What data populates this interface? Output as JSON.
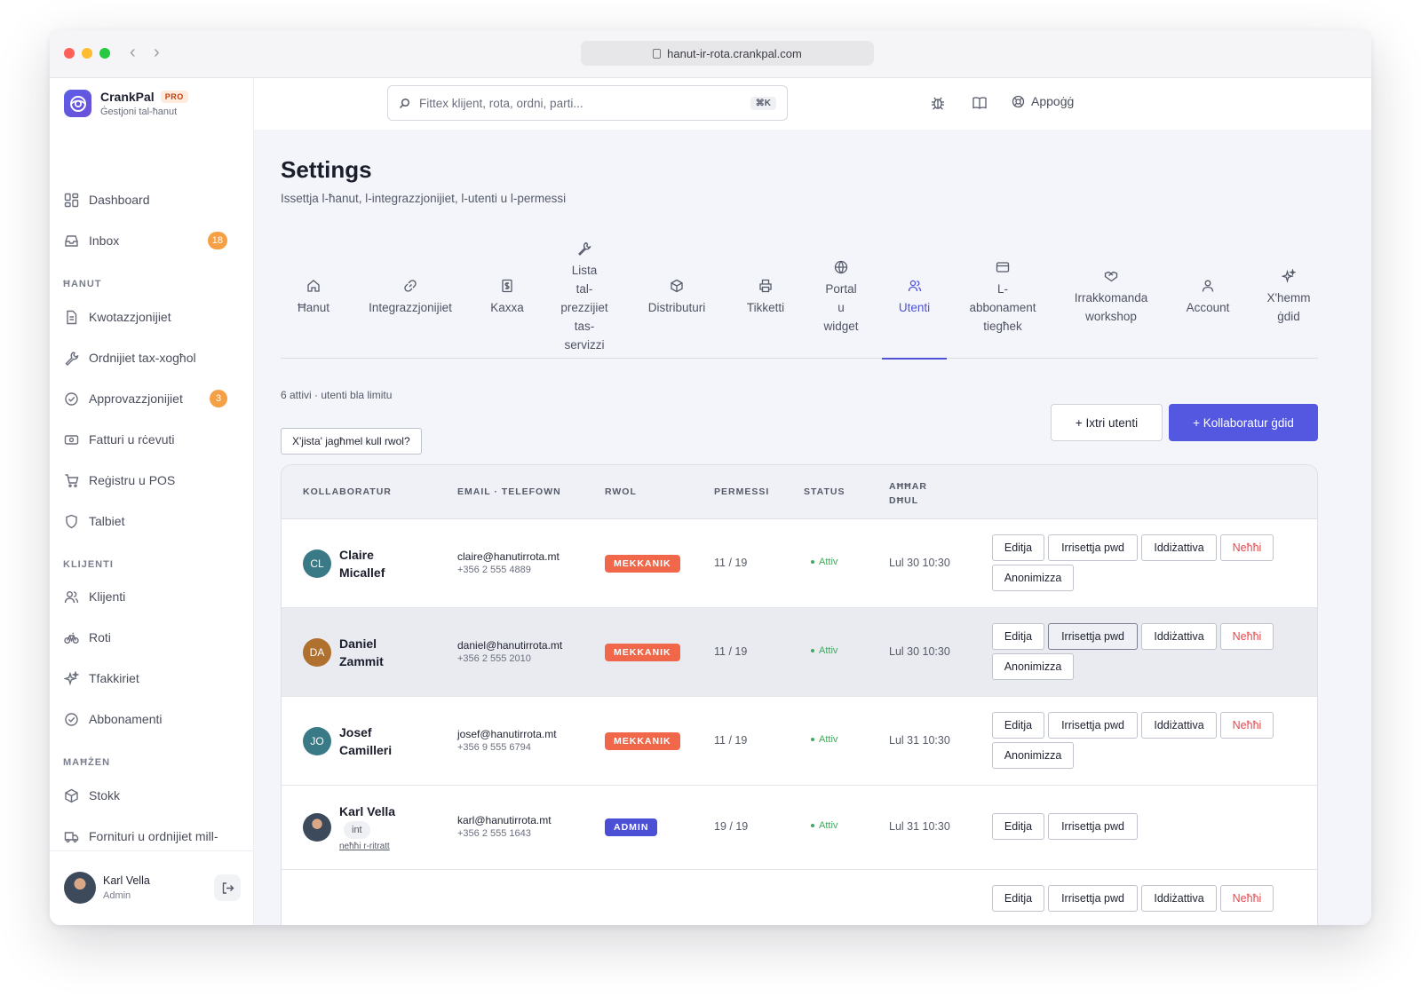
{
  "browser": {
    "url": "hanut-ir-rota.crankpal.com",
    "back_arrow": "‹",
    "forward_arrow": "›"
  },
  "brand": {
    "name": "CrankPal",
    "badge": "PRO",
    "subtitle": "Ġestjoni tal-ħanut"
  },
  "sidebar": {
    "items_top": [
      {
        "label": "Dashboard",
        "icon": "grid-icon"
      },
      {
        "label": "Inbox",
        "icon": "inbox-icon",
        "badge": "18"
      }
    ],
    "section_hanut": "ĦANUT",
    "items_hanut": [
      {
        "label": "Kwotazzjonijiet",
        "icon": "document-icon"
      },
      {
        "label": "Ordnijiet tax-xogħol",
        "icon": "wrench-icon"
      },
      {
        "label": "Approvazzjonijiet",
        "icon": "check-circle-icon",
        "badge": "3"
      },
      {
        "label": "Fatturi u rċevuti",
        "icon": "money-icon"
      },
      {
        "label": "Reġistru u POS",
        "icon": "cart-icon"
      },
      {
        "label": "Talbiet",
        "icon": "shield-icon"
      }
    ],
    "section_klijenti": "KLIJENTI",
    "items_klijenti": [
      {
        "label": "Klijenti",
        "icon": "users-icon"
      },
      {
        "label": "Roti",
        "icon": "bike-icon"
      },
      {
        "label": "Tfakkiriet",
        "icon": "sparkles-icon"
      },
      {
        "label": "Abbonamenti",
        "icon": "check-circle-icon"
      }
    ],
    "section_mahzen": "MAĦŻEN",
    "items_mahzen": [
      {
        "label": "Stokk",
        "icon": "box-icon"
      },
      {
        "label": "Fornituri u ordnijiet mill-",
        "icon": "truck-icon"
      }
    ],
    "footer": {
      "user_name": "Karl Vella",
      "user_role": "Admin"
    }
  },
  "header": {
    "search_placeholder": "Fittex klijent, rota, ordni, parti...",
    "search_shortcut": "⌘K",
    "help_label": "Appoġġ"
  },
  "page": {
    "title": "Settings",
    "subtitle": "Issettja l-ħanut, l-integrazzjonijiet, l-utenti u l-permessi"
  },
  "tabs": [
    {
      "label": "Ħanut",
      "icon": "home-icon"
    },
    {
      "label": "Integrazzjonijiet",
      "icon": "link-icon"
    },
    {
      "label": "Kaxxa",
      "icon": "cash-register-icon"
    },
    {
      "label": "Lista\ntal-\nprezzijiet\ntas-\nservizzi",
      "icon": "wrench-icon"
    },
    {
      "label": "Distributuri",
      "icon": "box-icon"
    },
    {
      "label": "Tikketti",
      "icon": "printer-icon"
    },
    {
      "label": "Portal\nu\nwidget",
      "icon": "globe-icon"
    },
    {
      "label": "Utenti",
      "icon": "users-icon",
      "active": true
    },
    {
      "label": "L-\nabbonament\ntiegħek",
      "icon": "card-icon"
    },
    {
      "label": "Irrakkomanda\nworkshop",
      "icon": "handshake-icon"
    },
    {
      "label": "Account",
      "icon": "user-icon"
    },
    {
      "label": "X'hemm\nġdid",
      "icon": "sparkles-icon"
    }
  ],
  "users_panel": {
    "count_text": "6 attivi · utenti bla limitu",
    "buy_users_button": "+ Ixtri utenti",
    "new_collaborator_button": "+ Kollaboratur ġdid",
    "role_info_button": "X'jista' jagħmel kull rwol?"
  },
  "table": {
    "headers": {
      "collaborator": "KOLLABORATUR",
      "contact": "EMAIL · TELEFOWN",
      "role": "RWOL",
      "permissions": "PERMESSI",
      "status": "STATUS",
      "last_login": "AĦĦAR\nDĦUL"
    },
    "actions": {
      "edit": "Editja",
      "reset_pwd": "Irrisettja pwd",
      "deactivate": "Iddiżattiva",
      "remove": "Neħħi",
      "anonymize": "Anonimizza"
    },
    "rows": [
      {
        "initials": "CL",
        "avatar_color": "#3a7a86",
        "name": "Claire\nMicallef",
        "email": "claire@hanutirrota.mt",
        "phone": "+356 2 555 4889",
        "role": "MEKKANIK",
        "role_color": "#f0674a",
        "permissions": "11 / 19",
        "status": "Attiv",
        "last_login": "Lul 30 10:30"
      },
      {
        "initials": "DA",
        "avatar_color": "#b0702e",
        "name": "Daniel\nZammit",
        "email": "daniel@hanutirrota.mt",
        "phone": "+356 2 555 2010",
        "role": "MEKKANIK",
        "role_color": "#f0674a",
        "permissions": "11 / 19",
        "status": "Attiv",
        "last_login": "Lul 30 10:30"
      },
      {
        "initials": "JO",
        "avatar_color": "#3a7a86",
        "name": "Josef\nCamilleri",
        "email": "josef@hanutirrota.mt",
        "phone": "+356 9 555 6794",
        "role": "MEKKANIK",
        "role_color": "#f0674a",
        "permissions": "11 / 19",
        "status": "Attiv",
        "last_login": "Lul 31 10:30"
      },
      {
        "initials": "",
        "avatar_color": "#3c4a5c",
        "name": "Karl Vella",
        "badge": "int",
        "photo_link": "neħħi r-ritratt",
        "email": "karl@hanutirrota.mt",
        "phone": "+356 2 555 1643",
        "role": "ADMIN",
        "role_color": "#4b4fd6",
        "permissions": "19 / 19",
        "status": "Attiv",
        "last_login": "Lul 31 10:30"
      }
    ]
  }
}
